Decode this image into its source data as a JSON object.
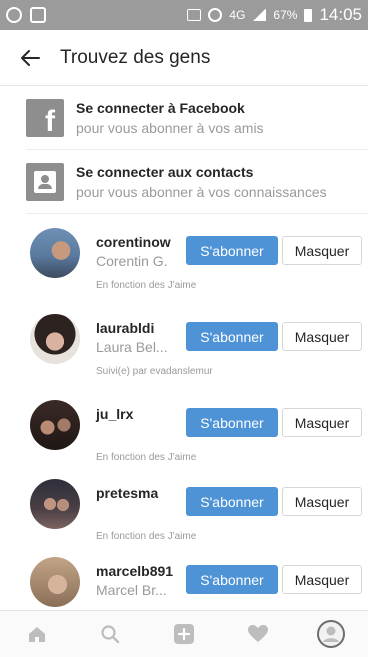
{
  "status_bar": {
    "network": "4G",
    "battery": "67%",
    "time": "14:05"
  },
  "header": {
    "title": "Trouvez des gens"
  },
  "connect": [
    {
      "icon": "facebook-icon",
      "title": "Se connecter à Facebook",
      "subtitle": "pour vous abonner à vos amis"
    },
    {
      "icon": "contacts-icon",
      "title": "Se connecter aux contacts",
      "subtitle": "pour vous abonner à vos connaissances"
    }
  ],
  "users": [
    {
      "username": "corentinow",
      "fullname": "Corentin G.",
      "reason": "En fonction des J'aime",
      "follow_label": "S'abonner",
      "hide_label": "Masquer"
    },
    {
      "username": "laurabldi",
      "fullname": "Laura Bel...",
      "reason": "Suivi(e) par evadanslemur",
      "follow_label": "S'abonner",
      "hide_label": "Masquer"
    },
    {
      "username": "ju_lrx",
      "fullname": "",
      "reason": "En fonction des J'aime",
      "follow_label": "S'abonner",
      "hide_label": "Masquer"
    },
    {
      "username": "pretesma",
      "fullname": "",
      "reason": "En fonction des J'aime",
      "follow_label": "S'abonner",
      "hide_label": "Masquer"
    },
    {
      "username": "marcelb891",
      "fullname": "Marcel Br...",
      "reason": "",
      "follow_label": "S'abonner",
      "hide_label": "Masquer"
    }
  ],
  "colors": {
    "accent": "#4e93d6",
    "status_bar": "#9b9b9b",
    "secondary_text": "#9a9a9a"
  },
  "bottom_nav": [
    "home-icon",
    "search-icon",
    "add-icon",
    "heart-icon",
    "profile-icon"
  ]
}
